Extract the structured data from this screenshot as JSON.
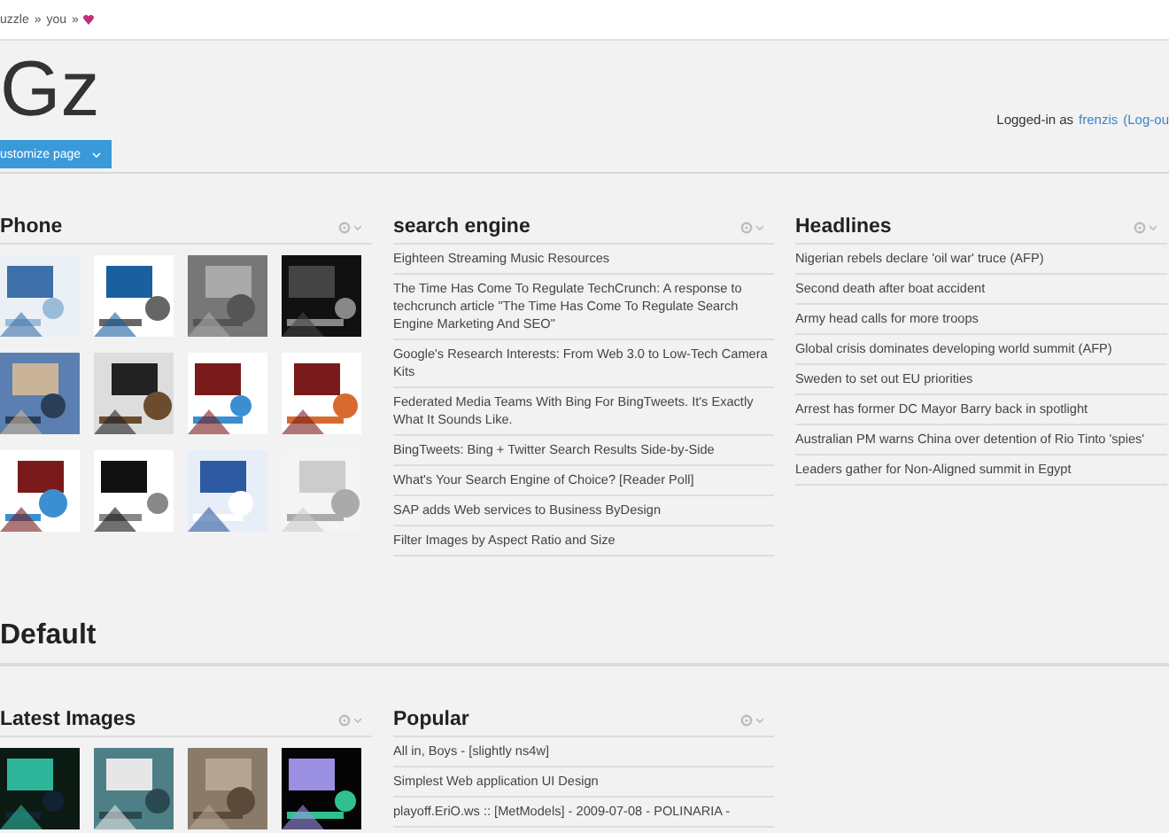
{
  "breadcrumb": {
    "items": [
      "uzzle",
      "»",
      "you",
      "»"
    ]
  },
  "header": {
    "title": "Gz",
    "customize_button": "ustomize page",
    "login": {
      "prefix": "Logged-in as",
      "user": "frenzis",
      "logout": "(Log-ou"
    }
  },
  "groups": [
    {
      "widgets": [
        {
          "kind": "images",
          "title": "Phone"
        },
        {
          "kind": "links",
          "title": "search engine",
          "items": [
            "Eighteen Streaming Music Resources",
            "The Time Has Come To Regulate TechCrunch: A response to techcrunch article \"The Time Has Come To Regulate Search Engine Marketing And SEO\"",
            "Google's Research Interests: From Web 3.0 to Low-Tech Camera Kits",
            "Federated Media Teams With Bing For BingTweets. It's Exactly What It Sounds Like.",
            "BingTweets: Bing + Twitter Search Results Side-by-Side",
            "What's Your Search Engine of Choice? [Reader Poll]",
            "SAP adds Web services to Business ByDesign",
            "Filter Images by Aspect Ratio and Size"
          ]
        },
        {
          "kind": "links",
          "title": "Headlines",
          "items": [
            "Nigerian rebels declare 'oil war' truce (AFP)",
            "Second death after boat accident",
            "Army head calls for more troops",
            "Global crisis dominates developing world summit (AFP)",
            "Sweden to set out EU priorities",
            "Arrest has former DC Mayor Barry back in spotlight",
            "Australian PM warns China over detention of Rio Tinto 'spies'",
            "Leaders gather for Non-Aligned summit in Egypt"
          ]
        }
      ]
    },
    {
      "title": "Default",
      "widgets": [
        {
          "kind": "images",
          "title": "Latest Images"
        },
        {
          "kind": "links",
          "title": "Popular",
          "items": [
            "All in, Boys - [slightly ns4w]",
            "Simplest Web application UI Design",
            "playoff.EriO.ws :: [MetModels] - 2009-07-08 - POLINARIA -"
          ]
        }
      ]
    }
  ]
}
